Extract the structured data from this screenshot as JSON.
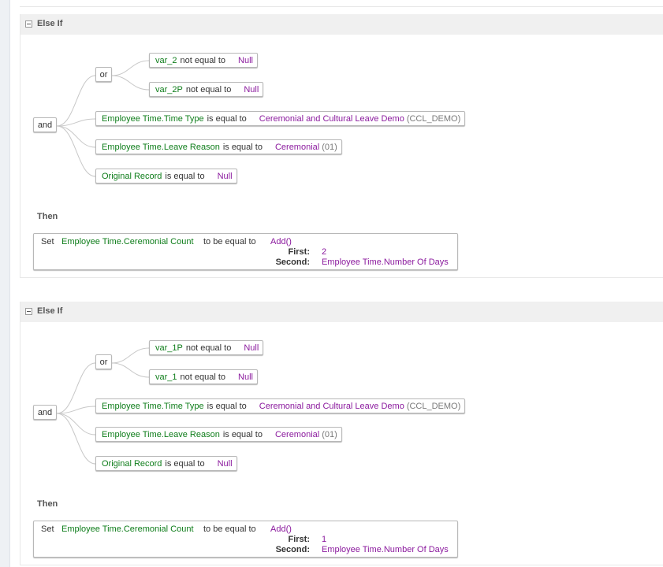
{
  "blocks": [
    {
      "header": "Else If",
      "and_label": "and",
      "or_label": "or",
      "or_conditions": [
        {
          "field": "var_2",
          "operator": "not equal to",
          "value": "Null"
        },
        {
          "field": "var_2P",
          "operator": "not equal to",
          "value": "Null"
        }
      ],
      "and_conditions": [
        {
          "field": "Employee Time.Time Type",
          "operator": "is equal to",
          "value": "Ceremonial and Cultural Leave Demo",
          "code": "(CCL_DEMO)"
        },
        {
          "field": "Employee Time.Leave Reason",
          "operator": "is equal to",
          "value": "Ceremonial",
          "code": "(01)"
        },
        {
          "field": "Original Record",
          "operator": "is equal to",
          "value": "Null"
        }
      ],
      "then_label": "Then",
      "action": {
        "keyword": "Set",
        "field": "Employee Time.Ceremonial Count",
        "operator": "to be equal to",
        "function": "Add()",
        "params": [
          {
            "label": "First:",
            "value": "2"
          },
          {
            "label": "Second:",
            "value": "Employee Time.Number Of Days"
          }
        ]
      }
    },
    {
      "header": "Else If",
      "and_label": "and",
      "or_label": "or",
      "or_conditions": [
        {
          "field": "var_1P",
          "operator": "not equal to",
          "value": "Null"
        },
        {
          "field": "var_1",
          "operator": "not equal to",
          "value": "Null"
        }
      ],
      "and_conditions": [
        {
          "field": "Employee Time.Time Type",
          "operator": "is equal to",
          "value": "Ceremonial and Cultural Leave Demo",
          "code": "(CCL_DEMO)"
        },
        {
          "field": "Employee Time.Leave Reason",
          "operator": "is equal to",
          "value": "Ceremonial",
          "code": "(01)"
        },
        {
          "field": "Original Record",
          "operator": "is equal to",
          "value": "Null"
        }
      ],
      "then_label": "Then",
      "action": {
        "keyword": "Set",
        "field": "Employee Time.Ceremonial Count",
        "operator": "to be equal to",
        "function": "Add()",
        "params": [
          {
            "label": "First:",
            "value": "1"
          },
          {
            "label": "Second:",
            "value": "Employee Time.Number Of Days"
          }
        ]
      }
    }
  ],
  "colors": {
    "field": "#0e7d1a",
    "value": "#8b1a9e",
    "header_bg": "#f0f0f0",
    "connector": "#c8c8c8"
  },
  "icons": {
    "collapse": "collapse-minus-icon"
  }
}
